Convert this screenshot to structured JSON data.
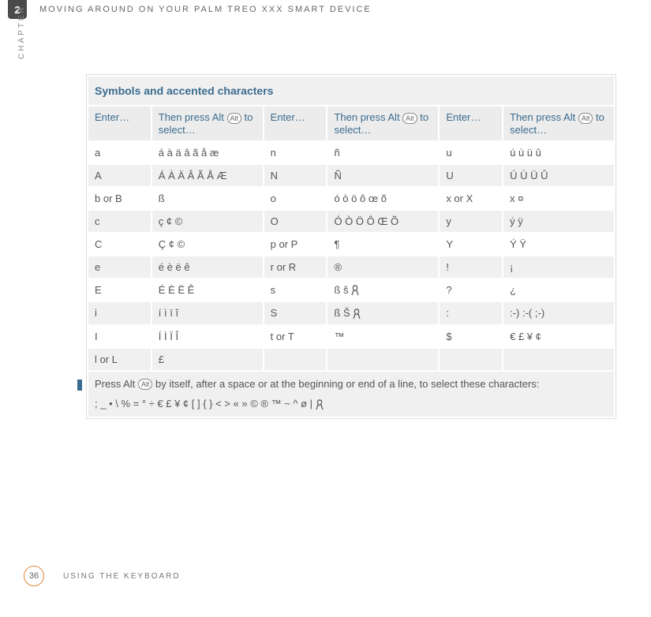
{
  "chapter_number": "2",
  "header_title": "MOVING AROUND ON YOUR PALM TREO XXX SMART DEVICE",
  "chapter_label": "CHAPTER",
  "table": {
    "title": "Symbols and accented characters",
    "head_enter": "Enter…",
    "head_select_pre": "Then press Alt ",
    "head_select_post": " to select…",
    "alt_key_label": "Alt",
    "rows": [
      {
        "alt": false,
        "c": [
          "a",
          "á à ä â ã å æ",
          "n",
          "ñ",
          "u",
          "ú ù ü û"
        ]
      },
      {
        "alt": true,
        "c": [
          "A",
          "Á À Ä Â Ã Å Æ",
          "N",
          "Ñ",
          "U",
          "Ú Ù Ü Û"
        ]
      },
      {
        "alt": false,
        "c": [
          "b or B",
          "ß",
          "o",
          "ó ò ö ô œ õ",
          "x or X",
          "x ¤"
        ]
      },
      {
        "alt": true,
        "c": [
          "c",
          "ç ¢ ©",
          "O",
          "Ó Ò Ö Ô Œ Õ",
          "y",
          " ý ÿ"
        ]
      },
      {
        "alt": false,
        "c": [
          "C",
          "Ç ¢ ©",
          "p or P",
          "¶",
          "Y",
          " Ý Ÿ"
        ]
      },
      {
        "alt": true,
        "c": [
          "e",
          "é è ë ê",
          "r or R",
          "®",
          "!",
          " ¡"
        ]
      },
      {
        "alt": false,
        "c": [
          "E",
          "É È Ë Ê",
          "s",
          "ß š RIBBON",
          "?",
          " ¿"
        ]
      },
      {
        "alt": true,
        "c": [
          "i",
          "í ì ï î",
          "S",
          "ß Š RIBBON",
          ":",
          ":-) :-( ;-)"
        ]
      },
      {
        "alt": false,
        "c": [
          "I",
          "Í Ì Ï Î",
          "t or T",
          "™",
          "$",
          "€ £ ¥ ¢"
        ]
      },
      {
        "alt": true,
        "c": [
          "l or L",
          "£",
          "",
          "",
          "",
          ""
        ]
      }
    ],
    "footnote_line1_pre": "Press Alt ",
    "footnote_line1_post": " by itself, after a space or at the beginning or end of a line, to select these characters:",
    "footnote_line2": "; _ • \\ % = ° ÷ €  £ ¥ ¢ [ ] { } < > « » © ® ™ ~ ^ ø | RIBBON"
  },
  "footer": {
    "page_number": "36",
    "section": "USING THE KEYBOARD"
  }
}
